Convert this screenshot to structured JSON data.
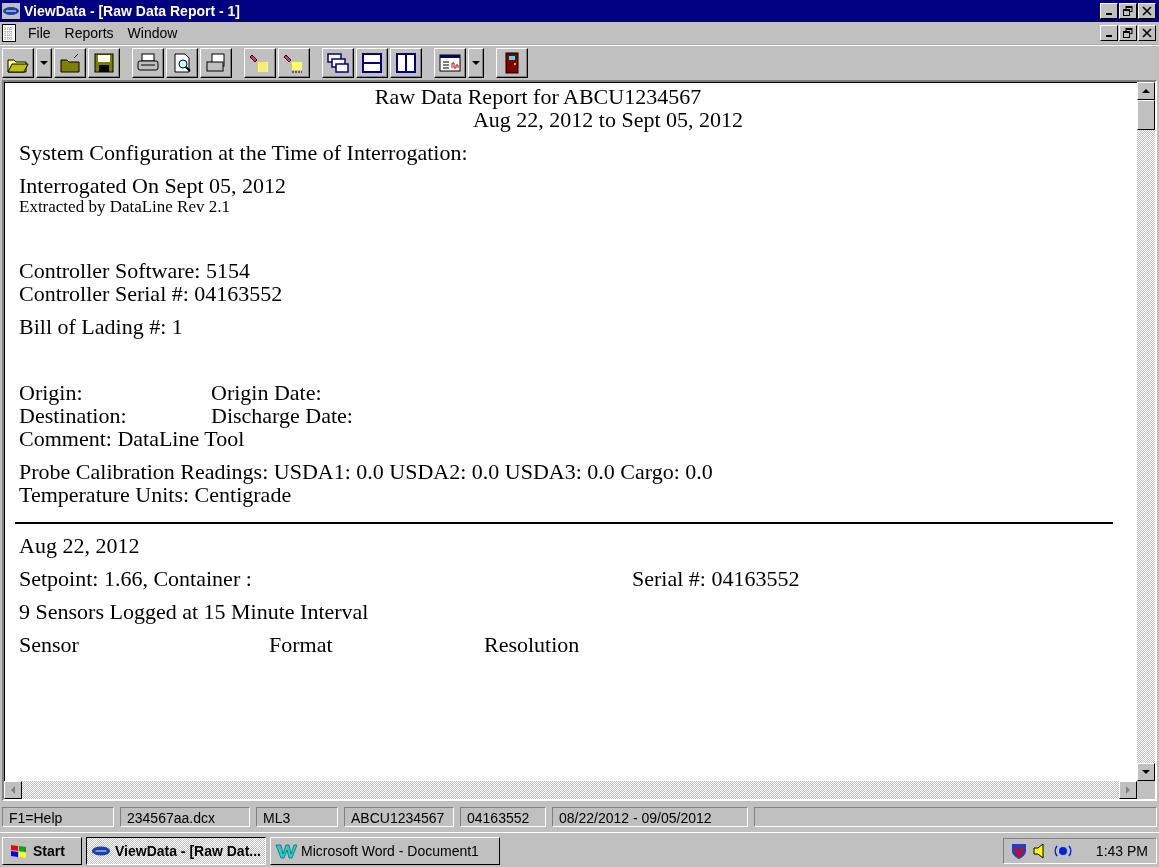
{
  "window": {
    "title": "ViewData - [Raw Data Report - 1]"
  },
  "menu": [
    "File",
    "Reports",
    "Window"
  ],
  "report": {
    "title": "Raw Data Report for ABCU1234567",
    "subtitle": "Aug 22, 2012 to Sept 05, 2012",
    "blocks": [
      {
        "kind": "lines",
        "rows": [
          {
            "kind": "text",
            "cells": [
              "System Configuration at the Time of Interrogation:"
            ]
          }
        ]
      },
      {
        "kind": "lines",
        "rows": [
          {
            "kind": "text",
            "cells": [
              "Interrogated On Sept 05, 2012"
            ]
          },
          {
            "kind": "small",
            "cells": [
              "Extracted by DataLine Rev 2.1"
            ]
          }
        ]
      },
      {
        "kind": "blank"
      },
      {
        "kind": "lines",
        "rows": [
          {
            "kind": "text",
            "cells": [
              "Controller Software: 5154"
            ]
          },
          {
            "kind": "text",
            "cells": [
              "Controller Serial #: 04163552"
            ]
          }
        ]
      },
      {
        "kind": "lines",
        "rows": [
          {
            "kind": "text",
            "cells": [
              "Bill of Lading #: 1"
            ]
          }
        ]
      },
      {
        "kind": "blank"
      },
      {
        "kind": "lines",
        "rows": [
          {
            "kind": "fields",
            "cells": [
              "Origin:",
              "Origin Date:"
            ]
          },
          {
            "kind": "fields",
            "cells": [
              "Destination:",
              "Discharge Date:"
            ]
          },
          {
            "kind": "text",
            "cells": [
              "Comment: DataLine Tool"
            ]
          }
        ]
      },
      {
        "kind": "lines",
        "rows": [
          {
            "kind": "text",
            "cells": [
              "Probe Calibration Readings: USDA1: 0.0 USDA2: 0.0 USDA3: 0.0 Cargo: 0.0"
            ]
          },
          {
            "kind": "text",
            "cells": [
              "Temperature Units: Centigrade"
            ]
          }
        ]
      },
      {
        "kind": "rule"
      },
      {
        "kind": "lines",
        "rows": [
          {
            "kind": "text",
            "cells": [
              "Aug 22, 2012"
            ]
          }
        ]
      },
      {
        "kind": "lines",
        "rows": [
          {
            "kind": "wide",
            "cells": [
              "Setpoint: 1.66, Container :",
              "Serial #: 04163552"
            ]
          }
        ]
      },
      {
        "kind": "lines",
        "rows": [
          {
            "kind": "text",
            "cells": [
              "9 Sensors Logged at 15 Minute Interval"
            ]
          }
        ]
      },
      {
        "kind": "lines",
        "rows": [
          {
            "kind": "columns",
            "cells": [
              "Sensor",
              "Format",
              "Resolution"
            ]
          }
        ]
      }
    ]
  },
  "status_bar": [
    "F1=Help",
    "234567aa.dcx",
    "ML3",
    "ABCU1234567",
    "04163552",
    "08/22/2012 - 09/05/2012"
  ],
  "taskbar": {
    "start": "Start",
    "tasks": [
      {
        "label": "ViewData - [Raw Dat...",
        "selected": true
      },
      {
        "label": "Microsoft Word - Document1",
        "selected": false
      }
    ],
    "clock": "1:43 PM"
  }
}
